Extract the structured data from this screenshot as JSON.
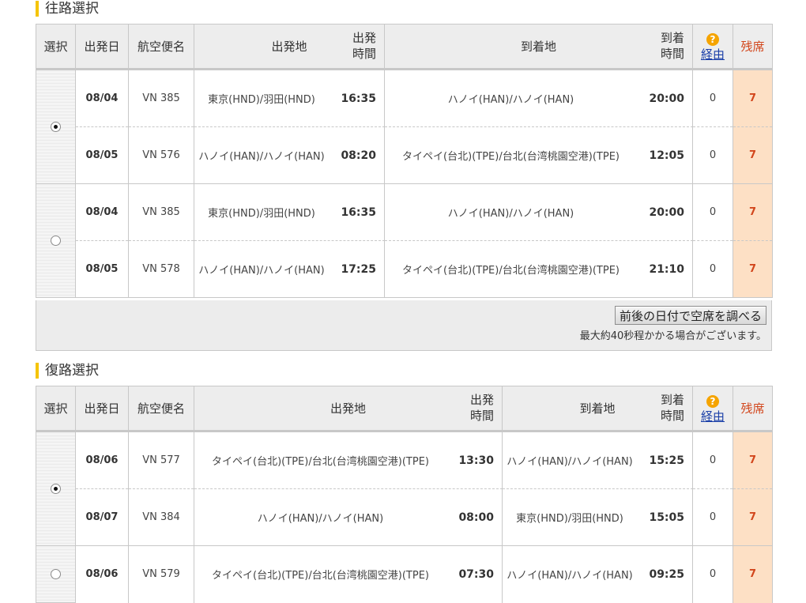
{
  "outbound": {
    "title": "往路選択",
    "headers": {
      "select": "選択",
      "date": "出発日",
      "flight": "航空便名",
      "from": "出発地",
      "dep_time": "出発\n時間",
      "to": "到着地",
      "arr_time": "到着\n時間",
      "via_icon": "?",
      "via": "経由",
      "seats": "残席"
    },
    "options": [
      {
        "selected": true,
        "legs": [
          {
            "date": "08/04",
            "flight": "VN 385",
            "from": "東京(HND)/羽田(HND)",
            "dep": "16:35",
            "to": "ハノイ(HAN)/ハノイ(HAN)",
            "arr": "20:00",
            "stops": "0",
            "seats": "7"
          },
          {
            "date": "08/05",
            "flight": "VN 576",
            "from": "ハノイ(HAN)/ハノイ(HAN)",
            "dep": "08:20",
            "to": "タイペイ(台北)(TPE)/台北(台湾桃園空港)(TPE)",
            "arr": "12:05",
            "stops": "0",
            "seats": "7"
          }
        ]
      },
      {
        "selected": false,
        "legs": [
          {
            "date": "08/04",
            "flight": "VN 385",
            "from": "東京(HND)/羽田(HND)",
            "dep": "16:35",
            "to": "ハノイ(HAN)/ハノイ(HAN)",
            "arr": "20:00",
            "stops": "0",
            "seats": "7"
          },
          {
            "date": "08/05",
            "flight": "VN 578",
            "from": "ハノイ(HAN)/ハノイ(HAN)",
            "dep": "17:25",
            "to": "タイペイ(台北)(TPE)/台北(台湾桃園空港)(TPE)",
            "arr": "21:10",
            "stops": "0",
            "seats": "7"
          }
        ]
      }
    ],
    "search_button": "前後の日付で空席を調べる",
    "note": "最大約40秒程かかる場合がございます。"
  },
  "return": {
    "title": "復路選択",
    "headers": {
      "select": "選択",
      "date": "出発日",
      "flight": "航空便名",
      "from": "出発地",
      "dep_time": "出発\n時間",
      "to": "到着地",
      "arr_time": "到着\n時間",
      "via_icon": "?",
      "via": "経由",
      "seats": "残席"
    },
    "options": [
      {
        "selected": true,
        "legs": [
          {
            "date": "08/06",
            "flight": "VN 577",
            "from": "タイペイ(台北)(TPE)/台北(台湾桃園空港)(TPE)",
            "dep": "13:30",
            "to": "ハノイ(HAN)/ハノイ(HAN)",
            "arr": "15:25",
            "stops": "0",
            "seats": "7"
          },
          {
            "date": "08/07",
            "flight": "VN 384",
            "from": "ハノイ(HAN)/ハノイ(HAN)",
            "dep": "08:00",
            "to": "東京(HND)/羽田(HND)",
            "arr": "15:05",
            "stops": "0",
            "seats": "7"
          }
        ]
      },
      {
        "selected": false,
        "legs": [
          {
            "date": "08/06",
            "flight": "VN 579",
            "from": "タイペイ(台北)(TPE)/台北(台湾桃園空港)(TPE)",
            "dep": "07:30",
            "to": "ハノイ(HAN)/ハノイ(HAN)",
            "arr": "09:25",
            "stops": "0",
            "seats": "7"
          }
        ]
      }
    ]
  }
}
